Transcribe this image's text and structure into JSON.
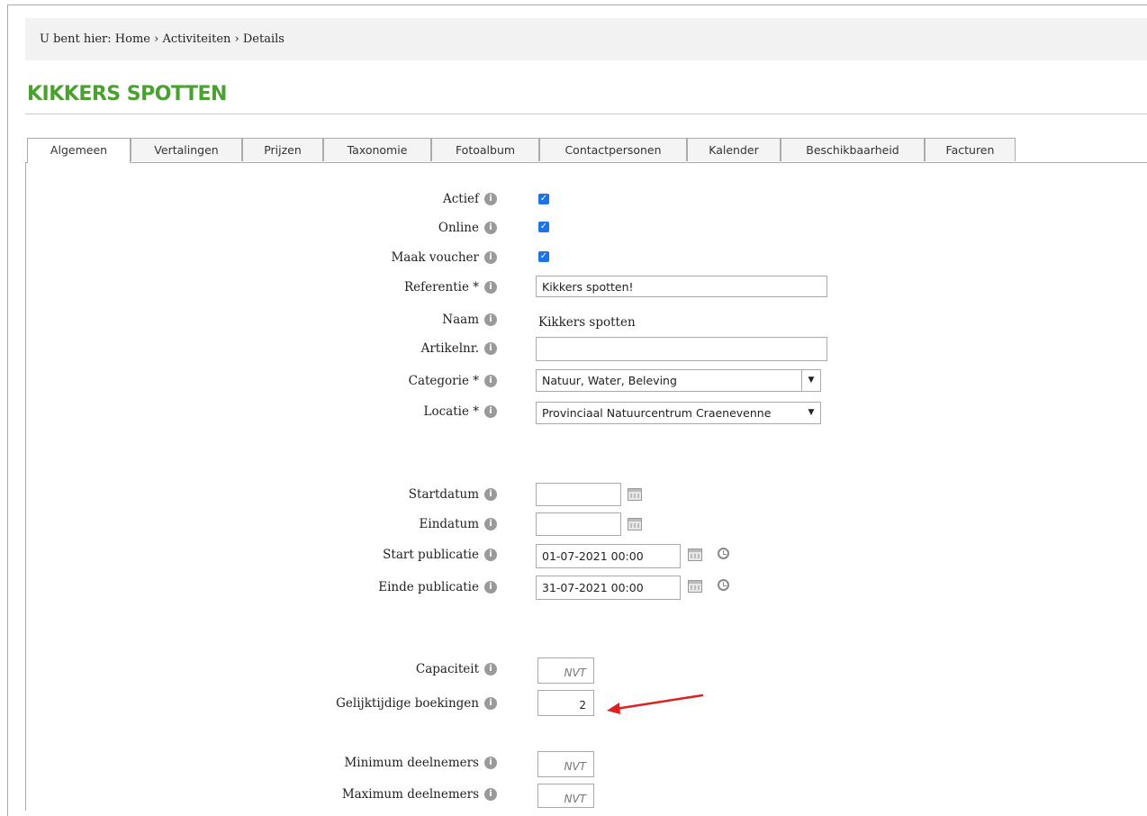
{
  "breadcrumb": {
    "prefix": "U bent hier:",
    "items": [
      "Home",
      "Activiteiten",
      "Details"
    ],
    "separator": "›"
  },
  "page_title": "KIKKERS SPOTTEN",
  "tabs": [
    {
      "label": "Algemeen",
      "active": true
    },
    {
      "label": "Vertalingen"
    },
    {
      "label": "Prijzen"
    },
    {
      "label": "Taxonomie"
    },
    {
      "label": "Fotoalbum"
    },
    {
      "label": "Contactpersonen"
    },
    {
      "label": "Kalender"
    },
    {
      "label": "Beschikbaarheid"
    },
    {
      "label": "Facturen"
    }
  ],
  "form": {
    "actief_label": "Actief",
    "actief_checked": true,
    "online_label": "Online",
    "online_checked": true,
    "voucher_label": "Maak voucher",
    "voucher_checked": true,
    "referentie_label": "Referentie *",
    "referentie_value": "Kikkers spotten!",
    "naam_label": "Naam",
    "naam_value": "Kikkers spotten",
    "artikelnr_label": "Artikelnr.",
    "artikelnr_value": "",
    "categorie_label": "Categorie *",
    "categorie_value": "Natuur, Water, Beleving",
    "locatie_label": "Locatie *",
    "locatie_value": "Provinciaal Natuurcentrum Craenevenne",
    "startdatum_label": "Startdatum",
    "startdatum_value": "",
    "eindatum_label": "Eindatum",
    "eindatum_value": "",
    "start_publicatie_label": "Start publicatie",
    "start_publicatie_value": "01-07-2021 00:00",
    "einde_publicatie_label": "Einde publicatie",
    "einde_publicatie_value": "31-07-2021 00:00",
    "capaciteit_label": "Capaciteit",
    "capaciteit_placeholder": "NVT",
    "gelijktijdige_label": "Gelijktijdige boekingen",
    "gelijktijdige_value": "2",
    "min_deelnemers_label": "Minimum deelnemers",
    "min_deelnemers_placeholder": "NVT",
    "max_deelnemers_label": "Maximum deelnemers",
    "max_deelnemers_placeholder": "NVT"
  },
  "info_icon_glyph": "i",
  "colors": {
    "title_green": "#4aa12f",
    "checkbox_blue": "#1a73e8",
    "annotation_arrow": "#e02020"
  }
}
